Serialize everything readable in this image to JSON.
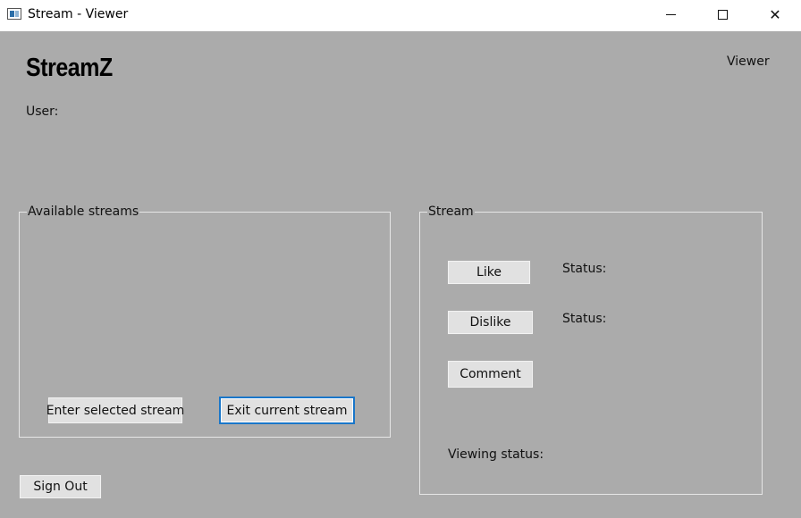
{
  "window": {
    "title": "Stream - Viewer",
    "controls": {
      "minimize": "minimize-icon",
      "maximize": "maximize-icon",
      "close": "close-icon"
    }
  },
  "header": {
    "logo": "StreamZ",
    "role": "Viewer",
    "user_label": "User:"
  },
  "available_streams": {
    "legend": "Available streams",
    "enter_button": "Enter selected stream",
    "exit_button": "Exit current stream"
  },
  "stream": {
    "legend": "Stream",
    "like_button": "Like",
    "like_status": "Status:",
    "dislike_button": "Dislike",
    "dislike_status": "Status:",
    "comment_button": "Comment",
    "viewing_status": "Viewing status:"
  },
  "footer": {
    "signout_button": "Sign Out"
  },
  "colors": {
    "background": "#ababab",
    "focus_border": "#1976c9"
  }
}
